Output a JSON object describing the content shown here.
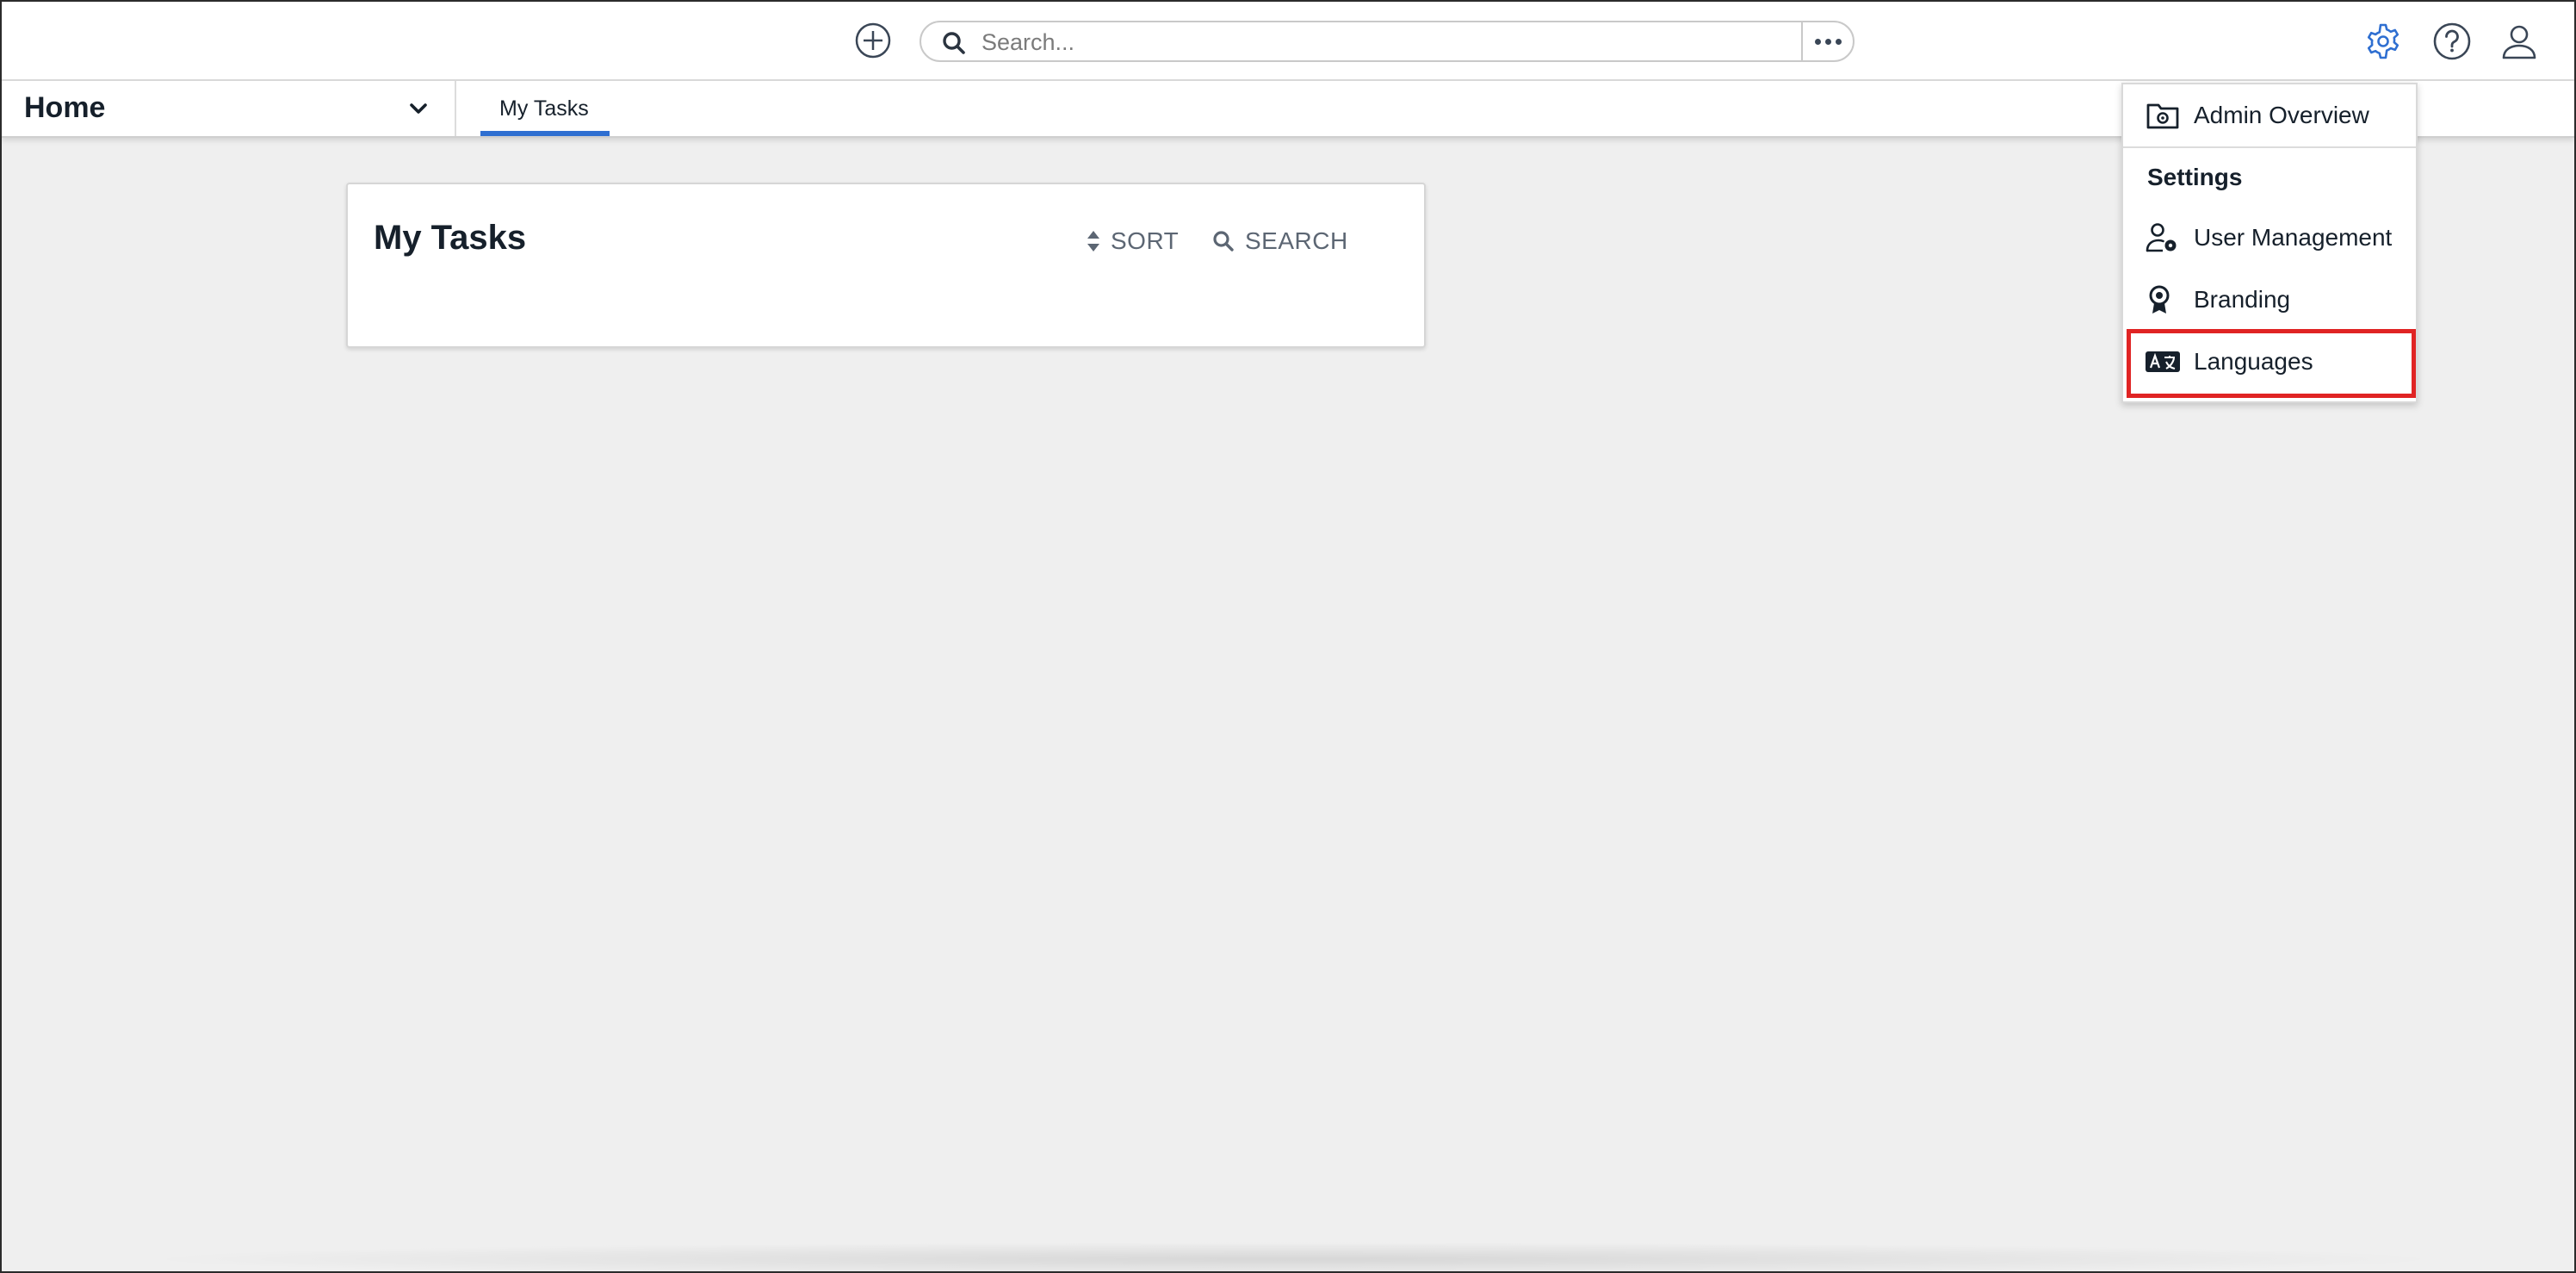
{
  "topbar": {
    "add_icon": "plus-circle-icon",
    "search": {
      "placeholder": "Search...",
      "value": ""
    },
    "more_icon": "ellipsis-icon",
    "settings_icon": "gear-icon",
    "help_icon": "help-circle-icon",
    "user_icon": "user-icon",
    "accent_color": "#2f6fd1"
  },
  "nav": {
    "home_label": "Home",
    "tabs": [
      {
        "label": "My Tasks",
        "active": true
      }
    ]
  },
  "card": {
    "title": "My Tasks",
    "sort_label": "SORT",
    "search_label": "SEARCH"
  },
  "menu": {
    "admin_overview": "Admin Overview",
    "section_title": "Settings",
    "items": [
      {
        "label": "User Management",
        "icon": "user-gear-icon"
      },
      {
        "label": "Branding",
        "icon": "award-icon"
      },
      {
        "label": "Languages",
        "icon": "language-icon",
        "highlighted": true
      }
    ],
    "highlight_color": "#e02424"
  }
}
